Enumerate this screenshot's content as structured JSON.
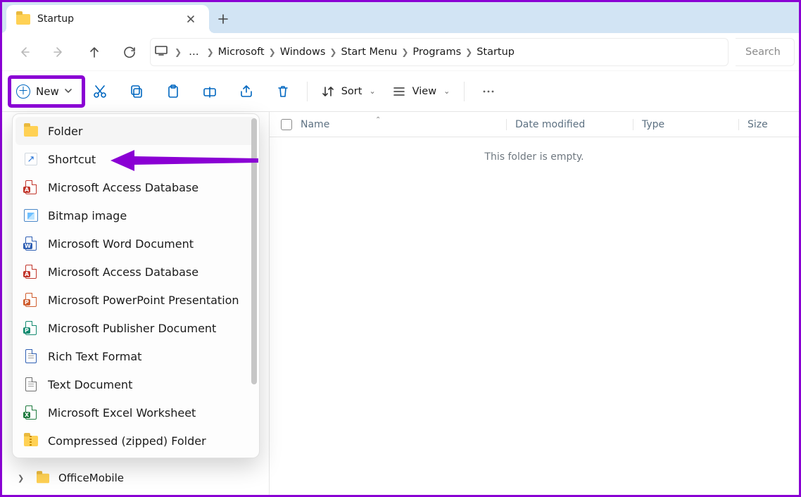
{
  "tab": {
    "title": "Startup"
  },
  "breadcrumbs": {
    "overflow": "…",
    "items": [
      "Microsoft",
      "Windows",
      "Start Menu",
      "Programs",
      "Startup"
    ]
  },
  "search": {
    "placeholder": "Search"
  },
  "toolbar": {
    "new_label": "New",
    "sort_label": "Sort",
    "view_label": "View"
  },
  "new_menu": {
    "items": [
      {
        "label": "Folder",
        "icon": "folder"
      },
      {
        "label": "Shortcut",
        "icon": "shortcut"
      },
      {
        "label": "Microsoft Access Database",
        "icon": "access"
      },
      {
        "label": "Bitmap image",
        "icon": "bitmap"
      },
      {
        "label": "Microsoft Word Document",
        "icon": "word"
      },
      {
        "label": "Microsoft Access Database",
        "icon": "access"
      },
      {
        "label": "Microsoft PowerPoint Presentation",
        "icon": "powerpoint"
      },
      {
        "label": "Microsoft Publisher Document",
        "icon": "publisher"
      },
      {
        "label": "Rich Text Format",
        "icon": "rtf"
      },
      {
        "label": "Text Document",
        "icon": "text"
      },
      {
        "label": "Microsoft Excel Worksheet",
        "icon": "excel"
      },
      {
        "label": "Compressed (zipped) Folder",
        "icon": "zip"
      }
    ]
  },
  "columns": {
    "name": "Name",
    "date": "Date modified",
    "type": "Type",
    "size": "Size"
  },
  "empty_message": "This folder is empty.",
  "nav_tree": {
    "item_label": "OfficeMobile"
  }
}
